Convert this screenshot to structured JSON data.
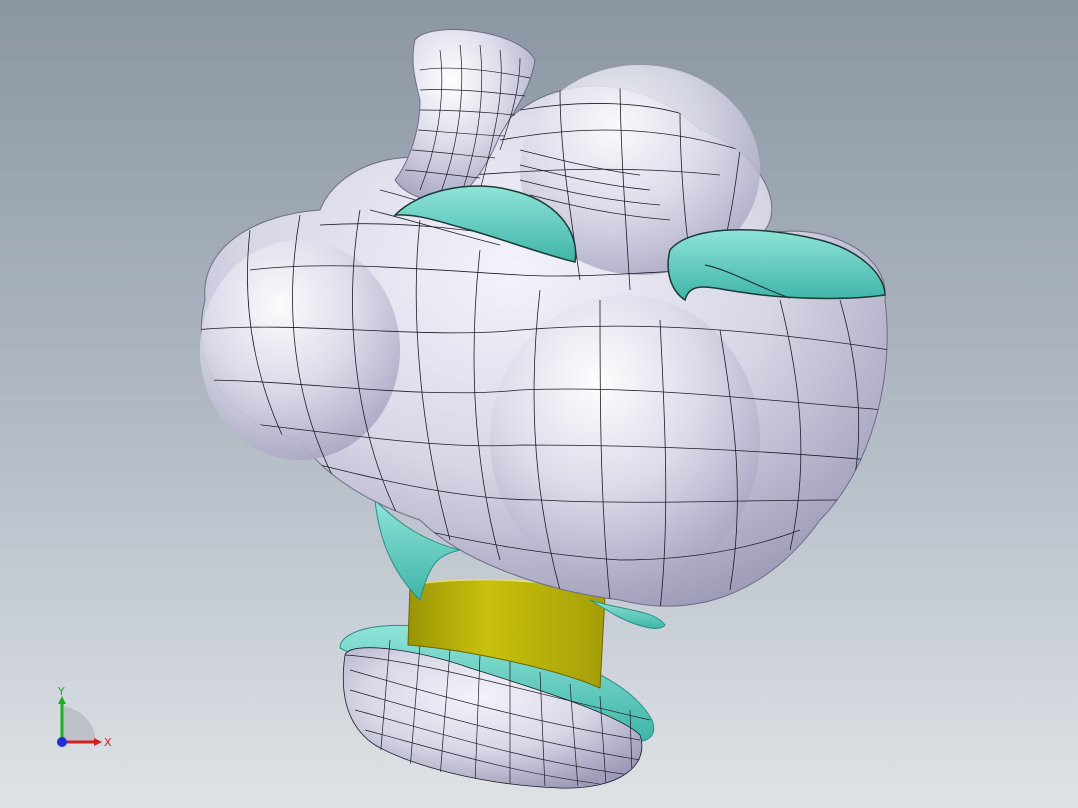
{
  "scene": {
    "colors": {
      "background_top": "#8b96a3",
      "background_bottom": "#dfe3e7",
      "body_surface": "#d7d6e6",
      "body_shadow": "#9e9cb8",
      "mesh_line": "#1c1c26",
      "teal_cap": "#6fd6c8",
      "teal_dark": "#2b8f84",
      "yellow_band": "#b3ad08"
    }
  },
  "triad": {
    "x_label": "X",
    "y_label": "Y",
    "x_color": "#d21f1f",
    "y_color": "#1fae1f",
    "z_color": "#1f2fd2"
  }
}
